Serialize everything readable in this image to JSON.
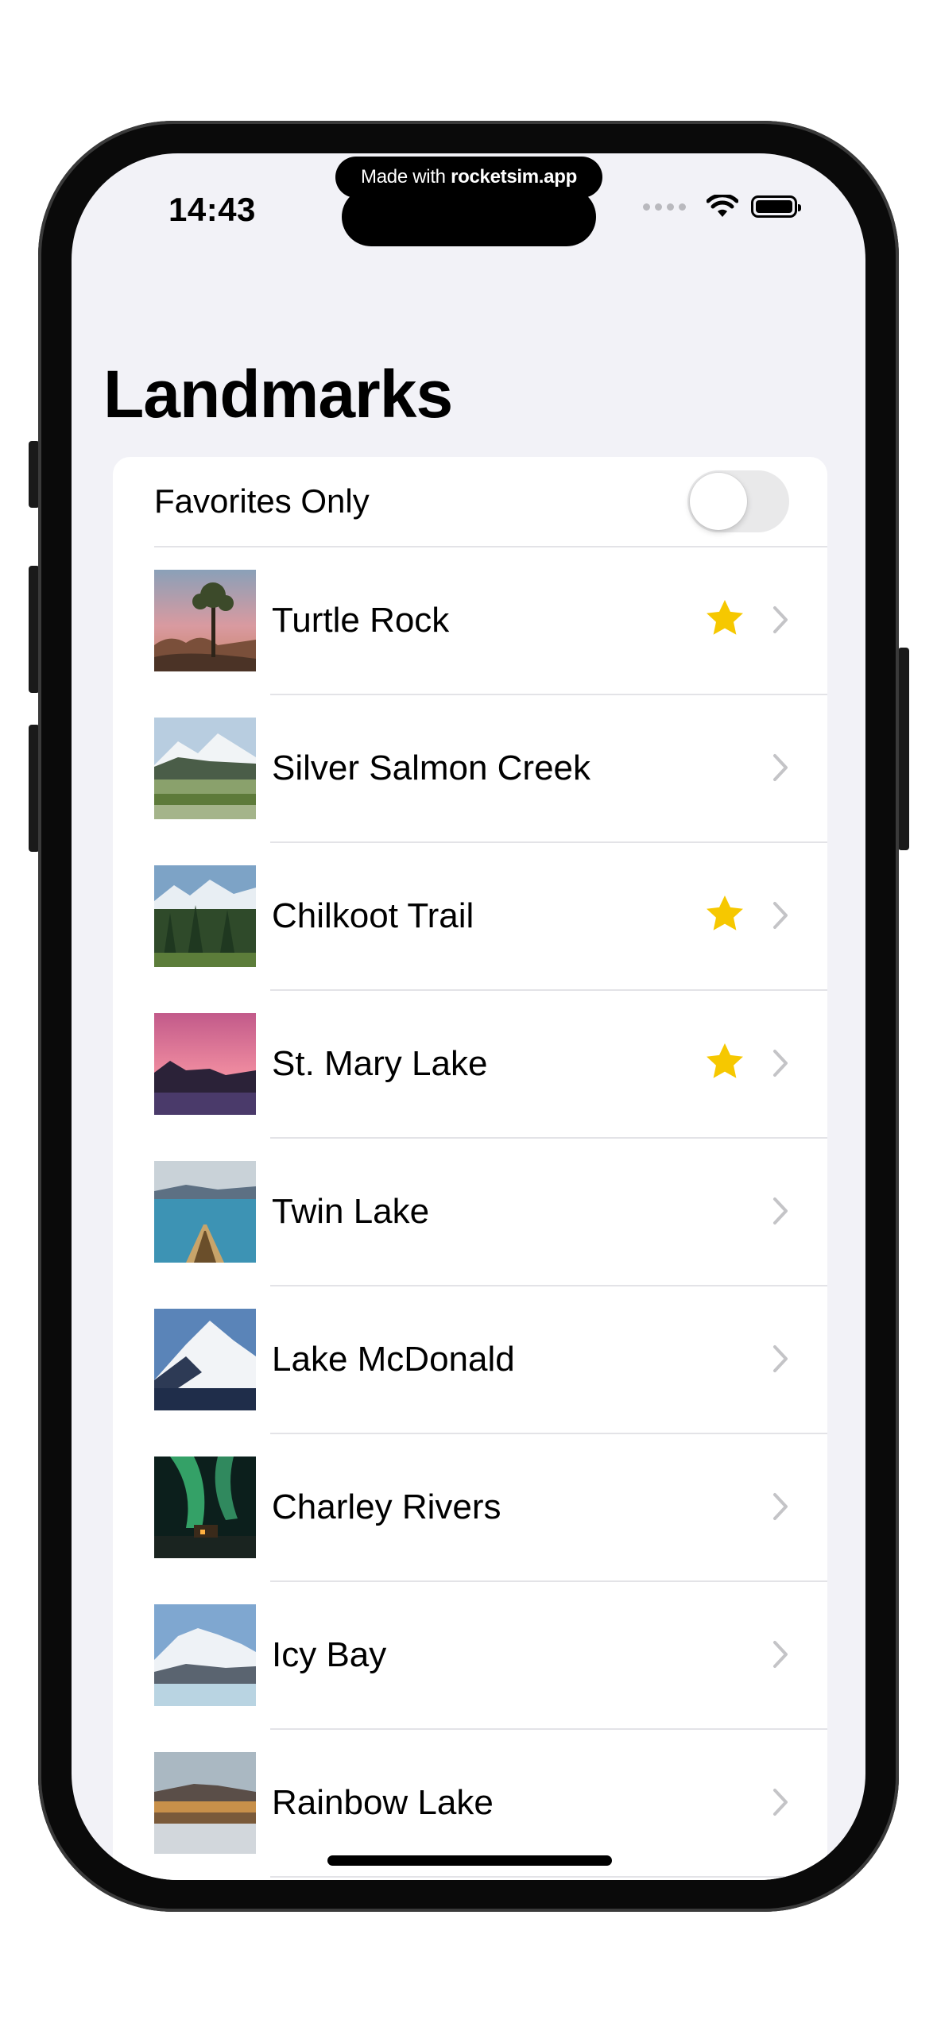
{
  "badge": {
    "prefix": "Made with ",
    "brand": "rocketsim.app"
  },
  "status_bar": {
    "time": "14:43"
  },
  "nav": {
    "title": "Landmarks"
  },
  "favorites_toggle": {
    "label": "Favorites Only",
    "on": false
  },
  "colors": {
    "star": "#f6c800",
    "chevron": "#c4c4c7",
    "background": "#f2f2f7"
  },
  "landmarks": [
    {
      "name": "Turtle Rock",
      "favorite": true
    },
    {
      "name": "Silver Salmon Creek",
      "favorite": false
    },
    {
      "name": "Chilkoot Trail",
      "favorite": true
    },
    {
      "name": "St. Mary Lake",
      "favorite": true
    },
    {
      "name": "Twin Lake",
      "favorite": false
    },
    {
      "name": "Lake McDonald",
      "favorite": false
    },
    {
      "name": "Charley Rivers",
      "favorite": false
    },
    {
      "name": "Icy Bay",
      "favorite": false
    },
    {
      "name": "Rainbow Lake",
      "favorite": false
    }
  ]
}
